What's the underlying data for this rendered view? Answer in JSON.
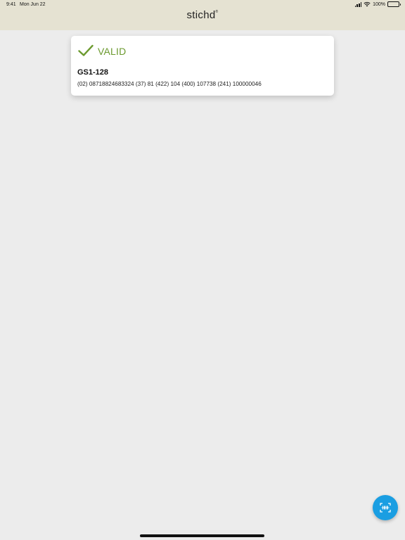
{
  "status_bar": {
    "time": "9:41",
    "date": "Mon Jun 22",
    "battery": "100%"
  },
  "header": {
    "logo": "stichd",
    "logo_mark": "®"
  },
  "result_card": {
    "status": "VALID",
    "status_color": "#6c9a2f",
    "barcode_type": "GS1-128",
    "barcode_data": "(02) 08718824683324 (37) 81 (422) 104 (400) 107738 (241) 100000046"
  },
  "scan_button": {
    "icon": "barcode-scan-icon",
    "color": "#1a9ee2"
  }
}
